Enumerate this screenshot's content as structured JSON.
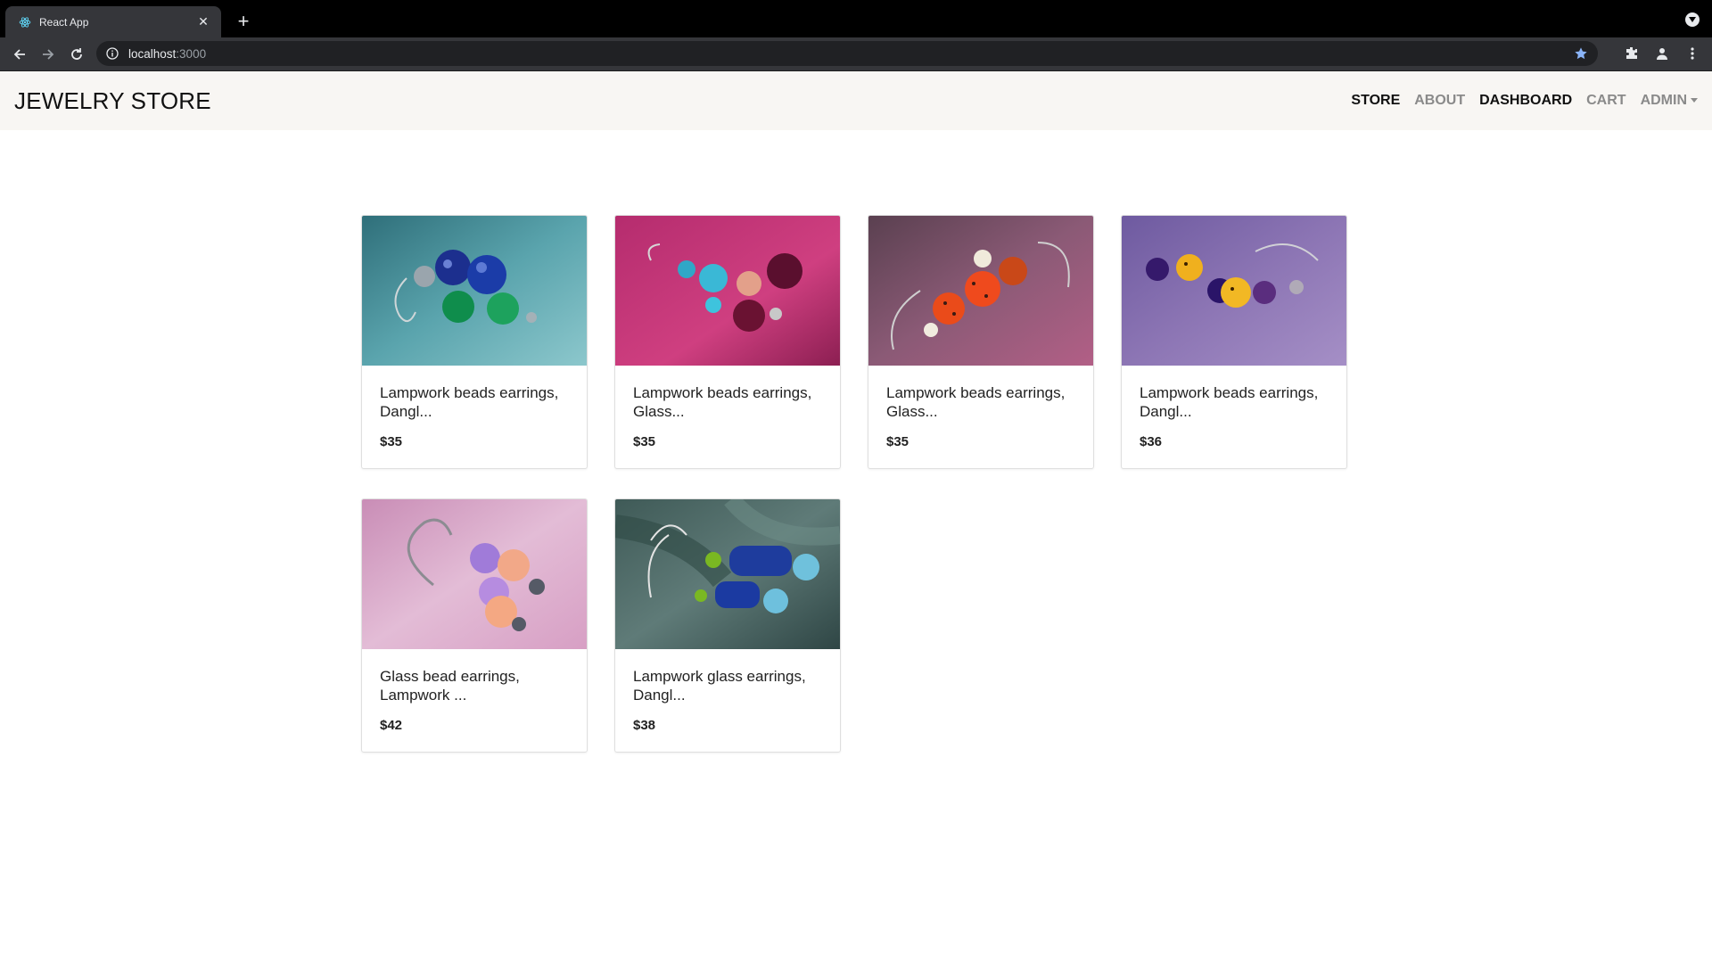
{
  "browser": {
    "tab_title": "React App",
    "url_host": "localhost",
    "url_port": ":3000"
  },
  "navbar": {
    "brand": "JEWELRY STORE",
    "links": [
      {
        "label": "STORE"
      },
      {
        "label": "ABOUT"
      },
      {
        "label": "DASHBOARD"
      },
      {
        "label": "CART"
      },
      {
        "label": "ADMIN"
      }
    ]
  },
  "products": [
    {
      "name": "Lampwork beads earrings,\nDangl...",
      "price": "$35"
    },
    {
      "name": "Lampwork beads earrings,\nGlass...",
      "price": "$35"
    },
    {
      "name": "Lampwork beads earrings,\nGlass...",
      "price": "$35"
    },
    {
      "name": "Lampwork beads earrings,\nDangl...",
      "price": "$36"
    },
    {
      "name": "Glass bead earrings,\nLampwork ...",
      "price": "$42"
    },
    {
      "name": "Lampwork glass earrings,\nDangl...",
      "price": "$38"
    }
  ],
  "colors": {
    "navbar_bg": "#f8f6f3",
    "brand_text": "#111111",
    "muted_link": "#8a8a8a"
  }
}
